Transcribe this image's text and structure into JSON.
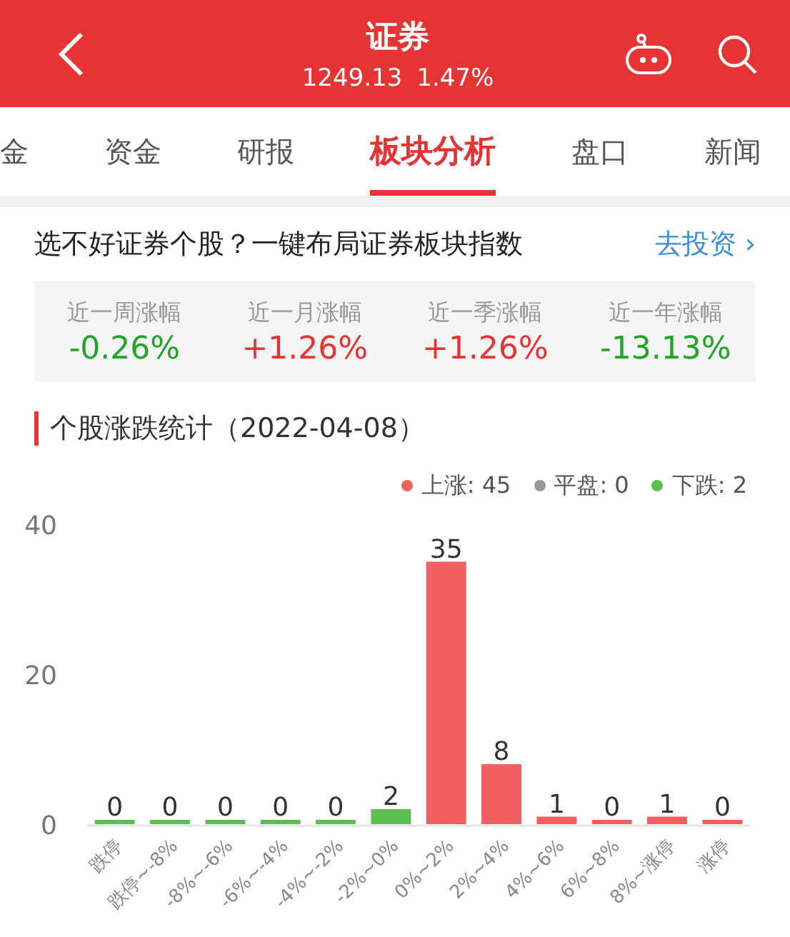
{
  "header": {
    "title": "证券",
    "price": "1249.13",
    "change": "1.47%"
  },
  "tabs": [
    {
      "label": "金",
      "selected": false
    },
    {
      "label": "资金",
      "selected": false
    },
    {
      "label": "研报",
      "selected": false
    },
    {
      "label": "板块分析",
      "selected": true
    },
    {
      "label": "盘口",
      "selected": false
    },
    {
      "label": "新闻",
      "selected": false
    }
  ],
  "promo": {
    "text": "选不好证券个股？一键布局证券板块指数",
    "link": "去投资",
    "chevron": "›"
  },
  "stats": [
    {
      "label": "近一周涨幅",
      "value": "-0.26%",
      "color": "#22a32a"
    },
    {
      "label": "近一月涨幅",
      "value": "+1.26%",
      "color": "#e63434"
    },
    {
      "label": "近一季涨幅",
      "value": "+1.26%",
      "color": "#e63434"
    },
    {
      "label": "近一年涨幅",
      "value": "-13.13%",
      "color": "#22a32a"
    }
  ],
  "section_title": "个股涨跌统计（2022-04-08）",
  "legend": [
    {
      "label": "上涨: 45",
      "color": "#f06060"
    },
    {
      "label": "平盘: 0",
      "color": "#999999"
    },
    {
      "label": "下跌: 2",
      "color": "#5cc050"
    }
  ],
  "chart_data": {
    "type": "bar",
    "categories": [
      "跌停",
      "跌停~-8%",
      "-8%~-6%",
      "-6%~-4%",
      "-4%~-2%",
      "-2%~0%",
      "0%~2%",
      "2%~4%",
      "4%~6%",
      "6%~8%",
      "8%~涨停",
      "涨停"
    ],
    "series": [
      {
        "color": "#5cc050",
        "values": [
          0,
          0,
          0,
          0,
          0,
          2,
          null,
          null,
          null,
          null,
          null,
          null
        ]
      },
      {
        "color": "#f06060",
        "values": [
          null,
          null,
          null,
          null,
          null,
          null,
          35,
          8,
          1,
          0,
          1,
          0
        ]
      }
    ],
    "ylim": [
      0,
      40
    ],
    "yticks": [
      0,
      20,
      40
    ],
    "data_labels": true
  }
}
